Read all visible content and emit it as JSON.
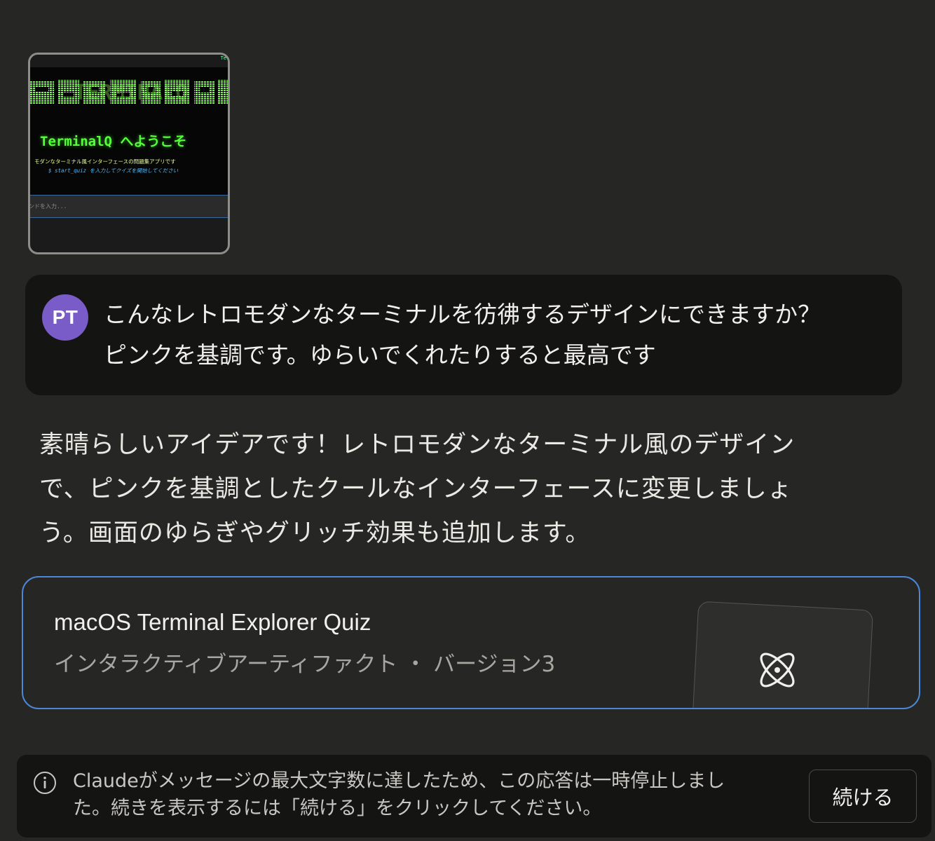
{
  "attachment": {
    "corner_text": "Te",
    "ascii_banner": "TERMINALQ",
    "title": "TerminalQ へようこそ",
    "subtitle": "モダンなターミナル風インターフェースの問題集アプリです",
    "hint": "$ start_quiz を入力してクイズを開始してください",
    "input_placeholder": "ンドを入力..."
  },
  "user_message": {
    "avatar_initials": "PT",
    "avatar_color": "#7a5cc8",
    "line1": "こんなレトロモダンなターミナルを彷彿するデザインにできますか？",
    "line2": "ピンクを基調です。ゆらいでくれたりすると最高です"
  },
  "assistant_reply": {
    "line1": "素晴らしいアイデアです！レトロモダンなターミナル風のデザイン",
    "line2": "で、ピンクを基調としたクールなインターフェースに変更しましょ",
    "line3": "う。画面のゆらぎやグリッチ効果も追加します。"
  },
  "artifact": {
    "title": "macOS Terminal Explorer Quiz",
    "subtitle": "インタラクティブアーティファクト ・ バージョン3",
    "icon": "atom-icon",
    "border_color": "#4d86d8"
  },
  "notice": {
    "icon": "info-icon",
    "line1": "Claudeがメッセージの最大文字数に達したため、この応答は一時停止しまし",
    "line2": "た。続きを表示するには「続ける」をクリックしてください。",
    "continue_label": "続ける"
  }
}
